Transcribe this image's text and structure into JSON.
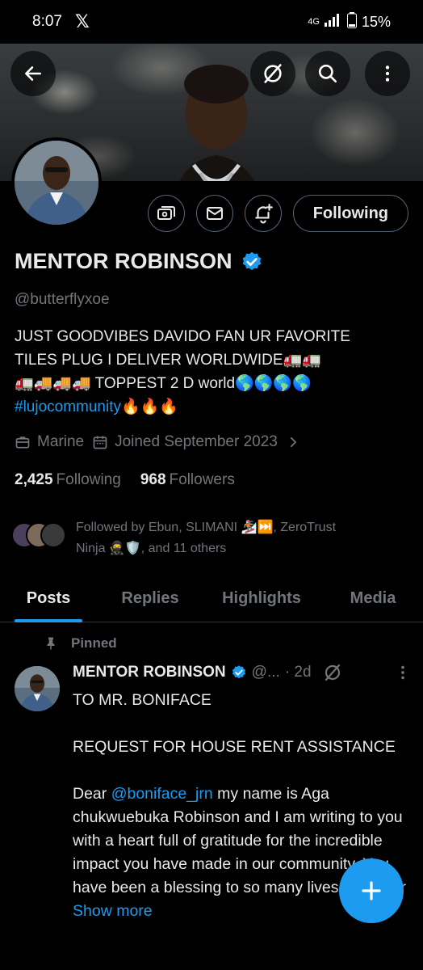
{
  "status_bar": {
    "time": "8:07",
    "x_glyph": "𝕏",
    "network": "4G",
    "battery": "15%"
  },
  "profile": {
    "name": "MENTOR ROBINSON",
    "handle": "@butterflyxoe",
    "bio_line1": "JUST GOODVIBES  DAVIDO FAN  UR FAVORITE",
    "bio_line2": "TILES PLUG I DELIVER WORLDWIDE🚛🚛",
    "bio_line3": "🚛🚚🚚🚚 TOPPEST 2 D world🌎🌎🌎🌎",
    "bio_hashtag": "#lujocommunity",
    "bio_emojis": "🔥🔥🔥",
    "profession": "Marine",
    "joined": "Joined September 2023",
    "following_count": "2,425",
    "following_label": "Following",
    "followers_count": "968",
    "followers_label": "Followers",
    "followed_by_line1": "Followed by Ebun, SLIMANI 🏂⏭️, ZeroTrust",
    "followed_by_line2": "Ninja 🥷🛡️, and 11 others",
    "following_button": "Following"
  },
  "tabs": [
    "Posts",
    "Replies",
    "Highlights",
    "Media"
  ],
  "pinned_post": {
    "pinned_label": "Pinned",
    "author": "MENTOR ROBINSON",
    "handle": "@...",
    "time": "· 2d",
    "line1": "TO MR. BONIFACE",
    "line2": "REQUEST FOR HOUSE RENT ASSISTANCE",
    "line3_start": "Dear ",
    "mention": "@boniface_jrn",
    "line3_rest": " my name is Aga chukwuebuka Robinson and I am writing to you with a heart full of gratitude for the incredible impact you have made in our community. You have been a blessing to so many lives with your ",
    "show_more": "Show more"
  },
  "colors": {
    "accent": "#1d9bf0",
    "muted": "#71767b",
    "text": "#e7e9ea",
    "background": "#000000"
  },
  "icons": [
    "back-arrow-icon",
    "grok-icon",
    "search-icon",
    "more-vertical-icon",
    "subscribe-icon",
    "message-icon",
    "notification-bell-icon",
    "verified-badge-icon",
    "briefcase-icon",
    "calendar-icon",
    "chevron-right-icon",
    "pin-icon",
    "plus-icon"
  ]
}
